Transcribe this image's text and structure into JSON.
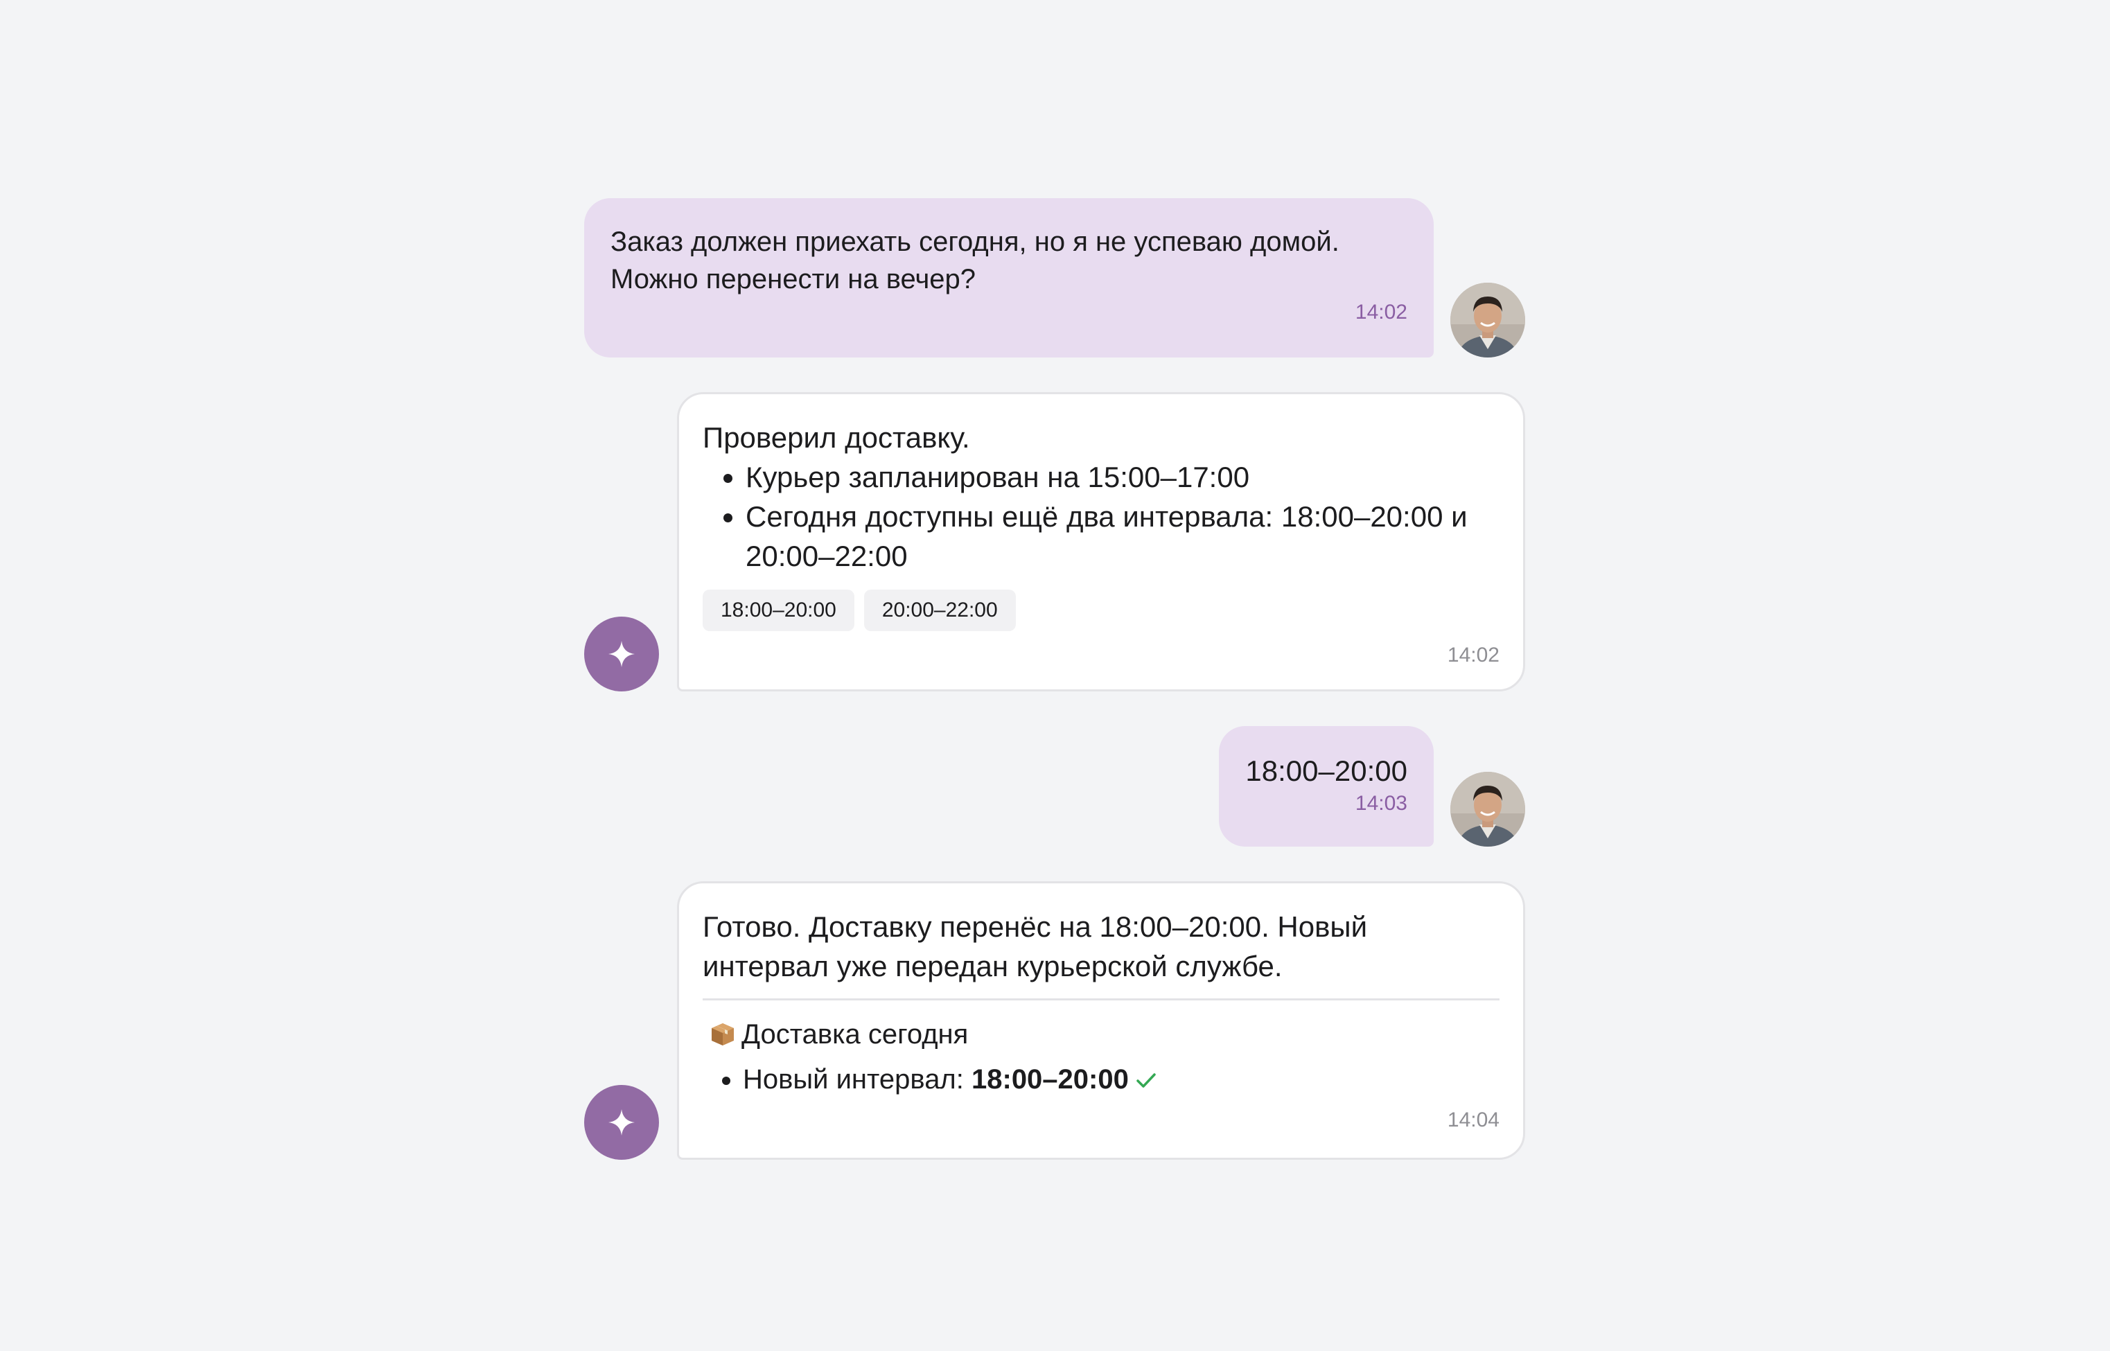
{
  "messages": [
    {
      "role": "user",
      "text_line1": "Заказ должен приехать сегодня, но я не успеваю домой.",
      "text_line2": "Можно перенести на вечер?",
      "time": "14:02"
    },
    {
      "role": "assistant",
      "intro": "Проверил доставку.",
      "bullets": [
        "Курьер запланирован на 15:00–17:00",
        "Сегодня доступны ещё два интервала: 18:00–20:00 и 20:00–22:00"
      ],
      "chips": [
        "18:00–20:00",
        "20:00–22:00"
      ],
      "time": "14:02"
    },
    {
      "role": "user",
      "text": "18:00–20:00",
      "time": "14:03"
    },
    {
      "role": "assistant",
      "text": "Готово. Доставку перенёс на 18:00–20:00. Новый интервал уже передан курьерской службе.",
      "card": {
        "title": "Доставка сегодня",
        "item_label": "Новый интервал: ",
        "item_value": "18:00–20:00"
      },
      "time": "14:04"
    }
  ],
  "colors": {
    "background": "#f3f4f6",
    "user_bubble": "#e8dcf0",
    "bot_avatar": "#926ba4",
    "user_time": "#8a5ea3",
    "check": "#34a853"
  },
  "icons": {
    "bot_avatar": "sparkle-icon",
    "card": "package-icon",
    "confirm": "check-icon"
  }
}
